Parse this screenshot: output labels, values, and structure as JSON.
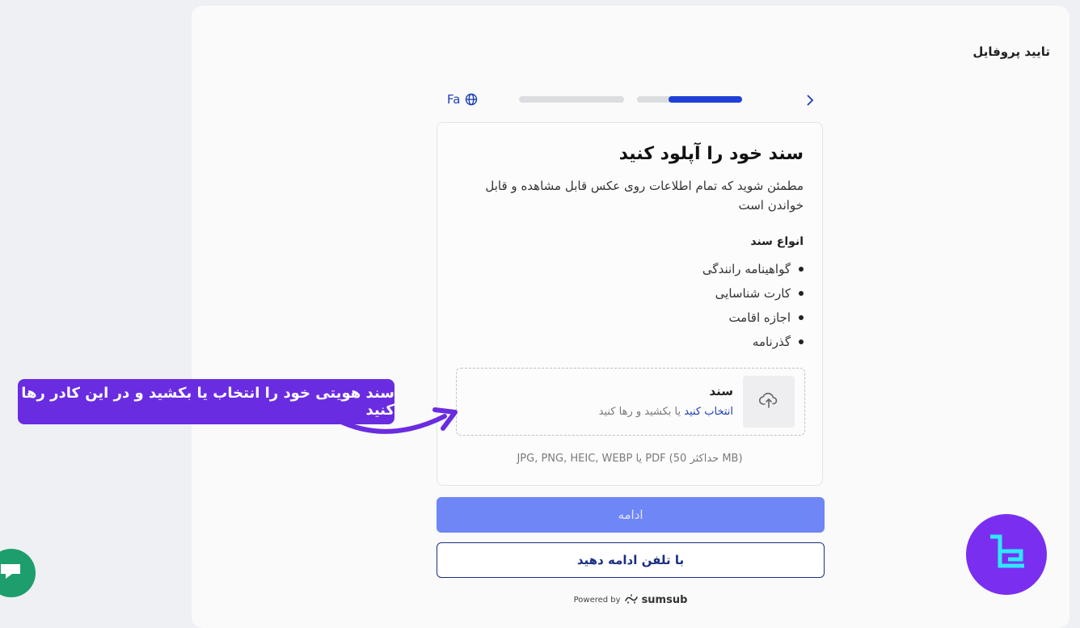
{
  "header": {
    "title": "تایید پروفایل"
  },
  "language": {
    "label": "Fa",
    "icon": "globe-icon"
  },
  "progress": {
    "steps_total": 2,
    "current_step": 2,
    "current_step_fill": 0.7
  },
  "card": {
    "heading": "سند خود را آپلود کنید",
    "description": "مطمئن شوید که تمام اطلاعات روی عکس قابل مشاهده و قابل خواندن است",
    "types_heading": "انواع سند",
    "types": [
      "گواهینامه رانندگی",
      "کارت شناسایی",
      "اجازه اقامت",
      "گذرنامه"
    ],
    "dropzone": {
      "title": "سند",
      "select_link": "انتخاب کنید",
      "subtitle_rest": " یا بکشید و رها کنید",
      "icon": "cloud-upload-icon"
    },
    "formats": "JPG, PNG, HEIC, WEBP یا PDF (حداکثر 50 MB)"
  },
  "buttons": {
    "continue": "ادامه",
    "phone": "با تلفن ادامه دهید"
  },
  "footer": {
    "powered_by": "Powered by",
    "brand": "sumsub"
  },
  "annotation": {
    "callout": "سند هویتی خود را انتخاب یا بکشید و در این کادر رها کنید"
  },
  "colors": {
    "accent": "#1f3fd6",
    "button_disabled": "#6f86f6",
    "callout": "#6a2ce0",
    "logo": "#7a2ff0",
    "chat": "#1d9e6c"
  }
}
